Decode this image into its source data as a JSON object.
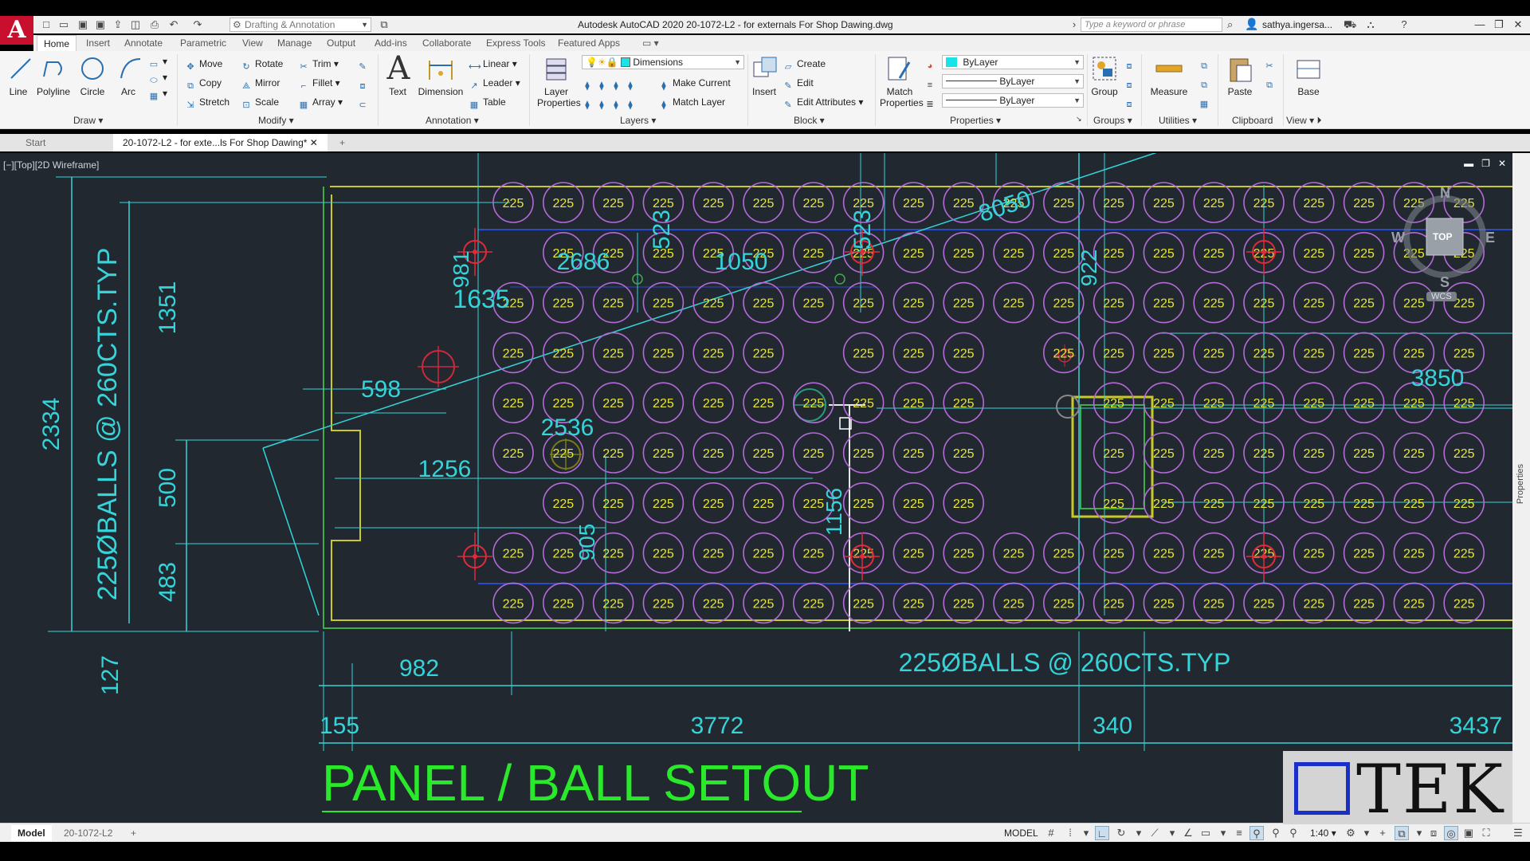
{
  "app": {
    "logo": "A",
    "title": "Autodesk AutoCAD 2020   20-1072-L2 - for externals  For Shop Dawing.dwg",
    "workspace": "Drafting & Annotation",
    "search_placeholder": "Type a keyword or phrase",
    "user": "sathya.ingersa..."
  },
  "ribbon_tabs": [
    "Home",
    "Insert",
    "Annotate",
    "Parametric",
    "View",
    "Manage",
    "Output",
    "Add-ins",
    "Collaborate",
    "Express Tools",
    "Featured Apps"
  ],
  "ribbon": {
    "draw": {
      "line": "Line",
      "polyline": "Polyline",
      "circle": "Circle",
      "arc": "Arc",
      "label": "Draw"
    },
    "modify": {
      "move": "Move",
      "rotate": "Rotate",
      "trim": "Trim",
      "copy": "Copy",
      "mirror": "Mirror",
      "fillet": "Fillet",
      "stretch": "Stretch",
      "scale": "Scale",
      "array": "Array",
      "label": "Modify"
    },
    "annotation": {
      "text": "Text",
      "dimension": "Dimension",
      "linear": "Linear",
      "leader": "Leader",
      "table": "Table",
      "label": "Annotation"
    },
    "layers": {
      "layer_properties": "Layer Properties",
      "current_layer": "Dimensions",
      "make_current": "Make Current",
      "match_layer": "Match Layer",
      "label": "Layers"
    },
    "block": {
      "insert": "Insert",
      "create": "Create",
      "edit": "Edit",
      "edit_attributes": "Edit Attributes",
      "label": "Block"
    },
    "properties": {
      "match_properties": "Match Properties",
      "color": "ByLayer",
      "linetype": "ByLayer",
      "lineweight": "ByLayer",
      "label": "Properties"
    },
    "groups": {
      "group": "Group",
      "label": "Groups"
    },
    "utilities": {
      "measure": "Measure",
      "label": "Utilities"
    },
    "clipboard": {
      "paste": "Paste",
      "label": "Clipboard"
    },
    "view": {
      "base": "Base",
      "label": "View"
    }
  },
  "doc_tabs": {
    "start": "Start",
    "active": "20-1072-L2 - for exte...ls  For Shop Dawing*"
  },
  "viewport": {
    "label": "[−][Top][2D Wireframe]",
    "viewcube": {
      "n": "N",
      "s": "S",
      "e": "E",
      "w": "W",
      "top": "TOP",
      "wcs": "WCS"
    }
  },
  "drawing": {
    "ball_label": "225",
    "dims": {
      "d2334": "2334",
      "d1351": "1351",
      "d500": "500",
      "d483": "483",
      "d127": "127",
      "d598": "598",
      "d981": "981",
      "d1635": "1635",
      "d2686": "2686",
      "d523a": "523",
      "d1050": "1050",
      "d523b": "523",
      "d8050": "8050",
      "d922": "922",
      "d3850": "3850",
      "d2536": "2536",
      "d1256": "1256",
      "d905": "905",
      "d1156": "1156",
      "d982": "982",
      "d155": "155",
      "d3772": "3772",
      "d340": "340",
      "d3437": "3437"
    },
    "note_vertical": "225ØBALLS @ 260CTS.TYP",
    "note_horizontal": "225ØBALLS @ 260CTS.TYP",
    "title": "PANEL / BALL SETOUT",
    "logo_text": "TEK1"
  },
  "side_panel": "Properties",
  "status": {
    "model_tab": "Model",
    "layout_tab": "20-1072-L2",
    "model_space": "MODEL",
    "scale": "1:40"
  }
}
